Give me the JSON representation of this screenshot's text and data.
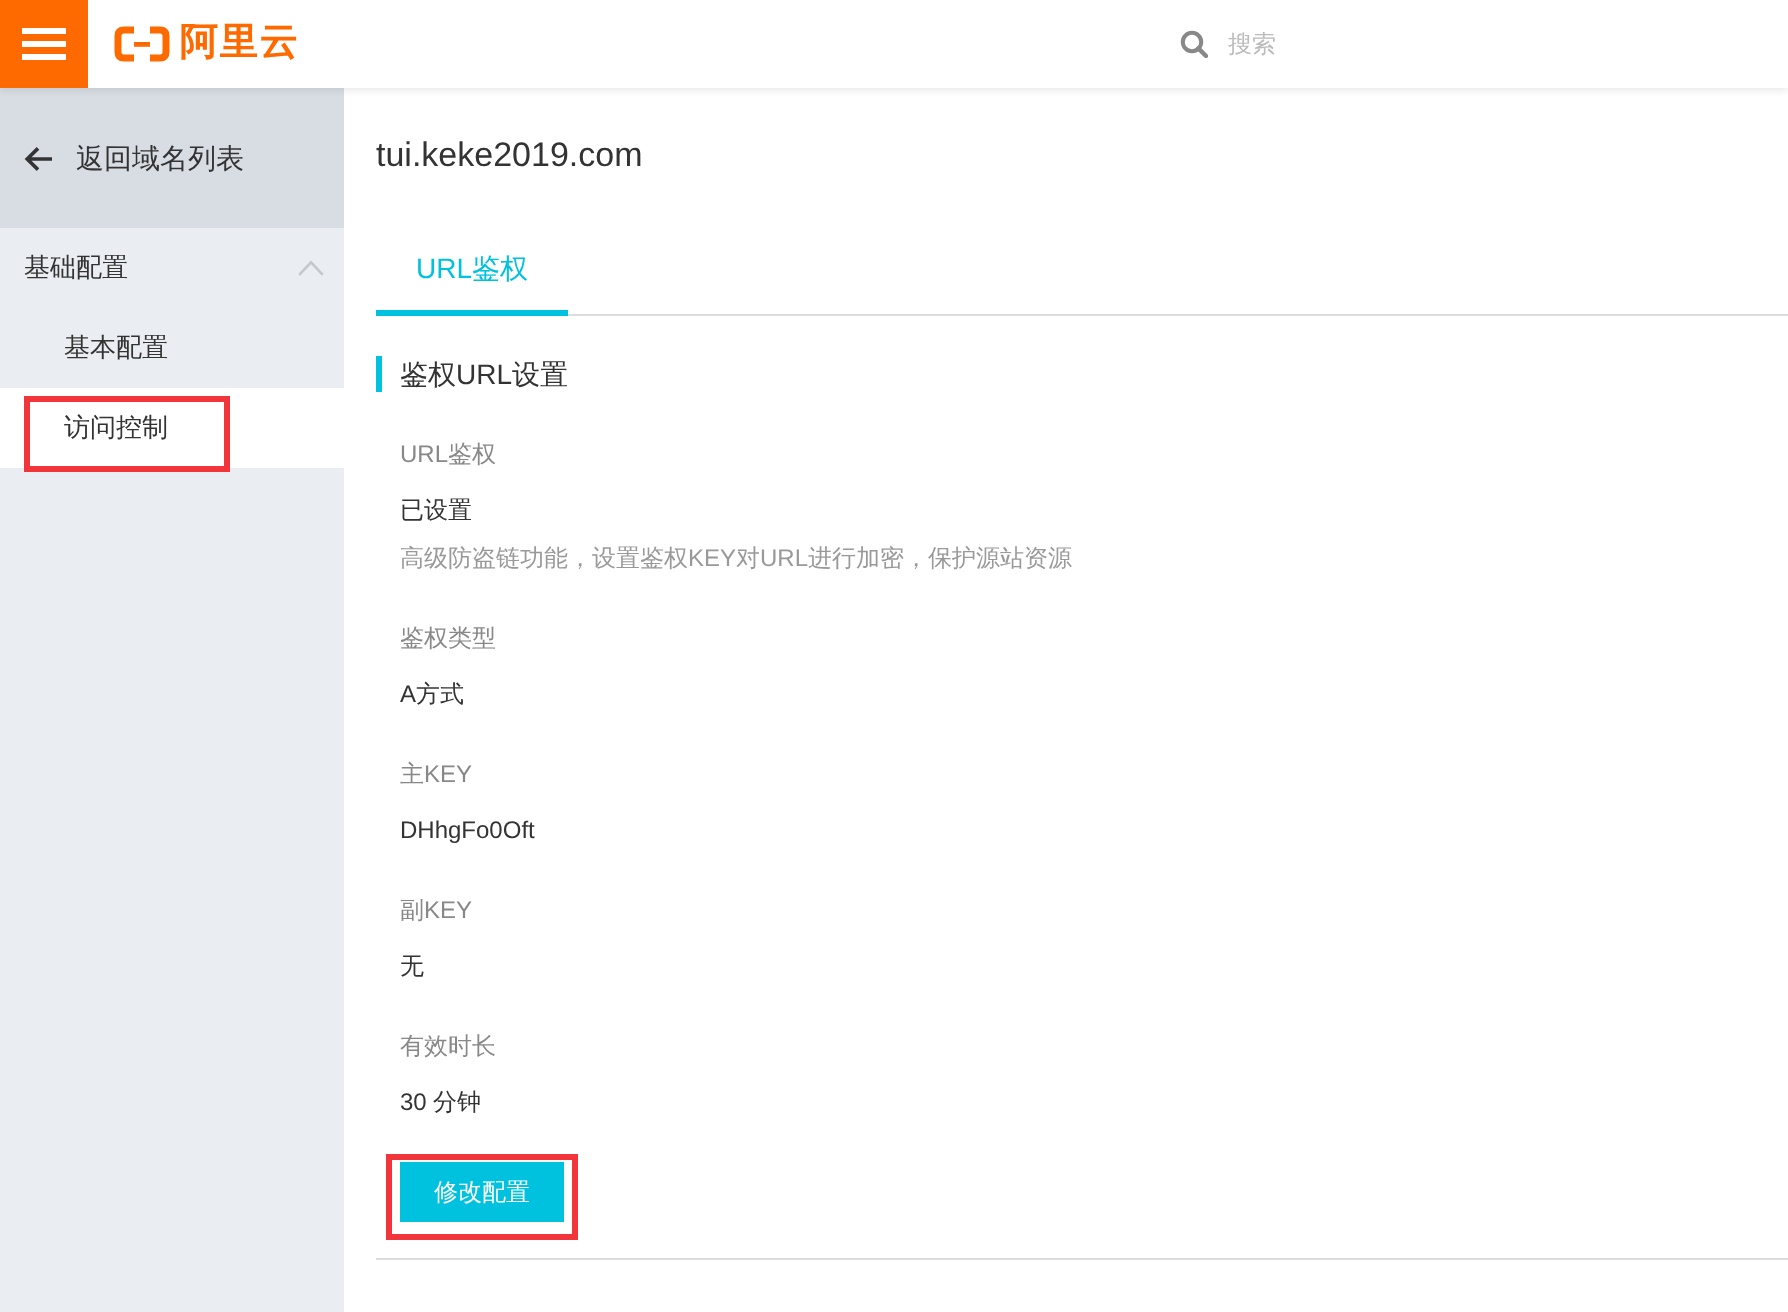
{
  "header": {
    "brand": "阿里云",
    "search": {
      "placeholder": "搜索"
    }
  },
  "sidebar": {
    "back_link": "返回域名列表",
    "groups": [
      {
        "label": "基础配置",
        "expanded": true,
        "items": [
          {
            "label": "基本配置",
            "selected": false,
            "highlighted": false
          },
          {
            "label": "访问控制",
            "selected": true,
            "highlighted": true
          }
        ]
      }
    ]
  },
  "main": {
    "title": "tui.keke2019.com",
    "tabs": [
      {
        "label": "URL鉴权",
        "selected": true
      }
    ],
    "section": {
      "title": "鉴权URL设置",
      "fields": [
        {
          "label": "URL鉴权",
          "value": "已设置",
          "hint": "高级防盗链功能，设置鉴权KEY对URL进行加密，保护源站资源"
        },
        {
          "label": "鉴权类型",
          "value": "A方式"
        },
        {
          "label": "主KEY",
          "value": "DHhgFo0Oft"
        },
        {
          "label": "副KEY",
          "value": "无"
        },
        {
          "label": "有效时长",
          "value": "30 分钟"
        }
      ]
    },
    "button": {
      "label": "修改配置",
      "highlighted": true
    }
  }
}
